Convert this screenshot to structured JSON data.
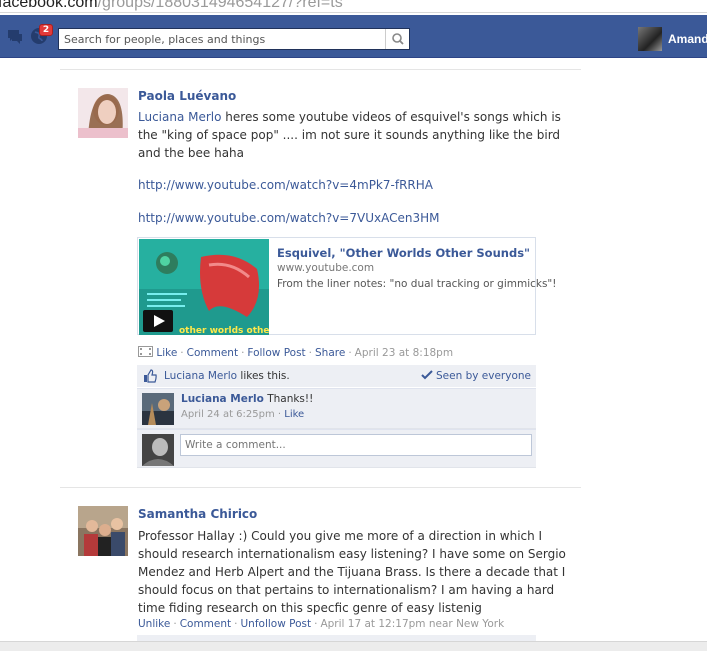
{
  "browser": {
    "url_host": "facebook.com",
    "url_path": "/groups/188031494654127/?ref=ts"
  },
  "topbar": {
    "notification_count": "2",
    "search_placeholder": "Search for people, places and things",
    "user_name": "Amand",
    "brand_color": "#3b5998"
  },
  "posts": [
    {
      "author": "Paola Luévano",
      "mention": "Luciana Merlo",
      "text": " heres some youtube videos of esquivel's songs which is the \"king of space pop\" .... im not sure it sounds anything like the bird and the bee haha",
      "links": [
        "http://www.youtube.com/watch?v=4mPk7-fRRHA",
        "http://www.youtube.com/watch?v=7VUxACen3HM"
      ],
      "share": {
        "title": "Esquivel, \"Other Worlds Other Sounds\"",
        "domain": "www.youtube.com",
        "description": "From the liner notes: \"no dual tracking or gimmicks\"!",
        "thumb_caption": "other worlds other sounds"
      },
      "actions": {
        "like": "Like",
        "comment": "Comment",
        "follow": "Follow Post",
        "share": "Share",
        "time": "April 23 at 8:18pm"
      },
      "likes": {
        "name": "Luciana Merlo",
        "suffix": " likes this.",
        "seen": "Seen by everyone"
      },
      "comment": {
        "author": "Luciana Merlo",
        "text": " Thanks!!",
        "time": "April 24 at 6:25pm",
        "like": "Like"
      },
      "write_placeholder": "Write a comment..."
    },
    {
      "author": "Samantha Chirico",
      "text": "Professor Hallay :) Could you give me more of a direction in which I should research internationalism easy listening? I have some on Sergio Mendez and Herb Alpert and the Tijuana Brass. Is there a decade that I should focus on that pertains to internationalism? I am having a hard time fiding research on this specfic genre of easy listenig",
      "actions": {
        "unlike": "Unlike",
        "comment": "Comment",
        "unfollow": "Unfollow Post",
        "time": "April 17 at 12:17pm near New York"
      }
    }
  ]
}
